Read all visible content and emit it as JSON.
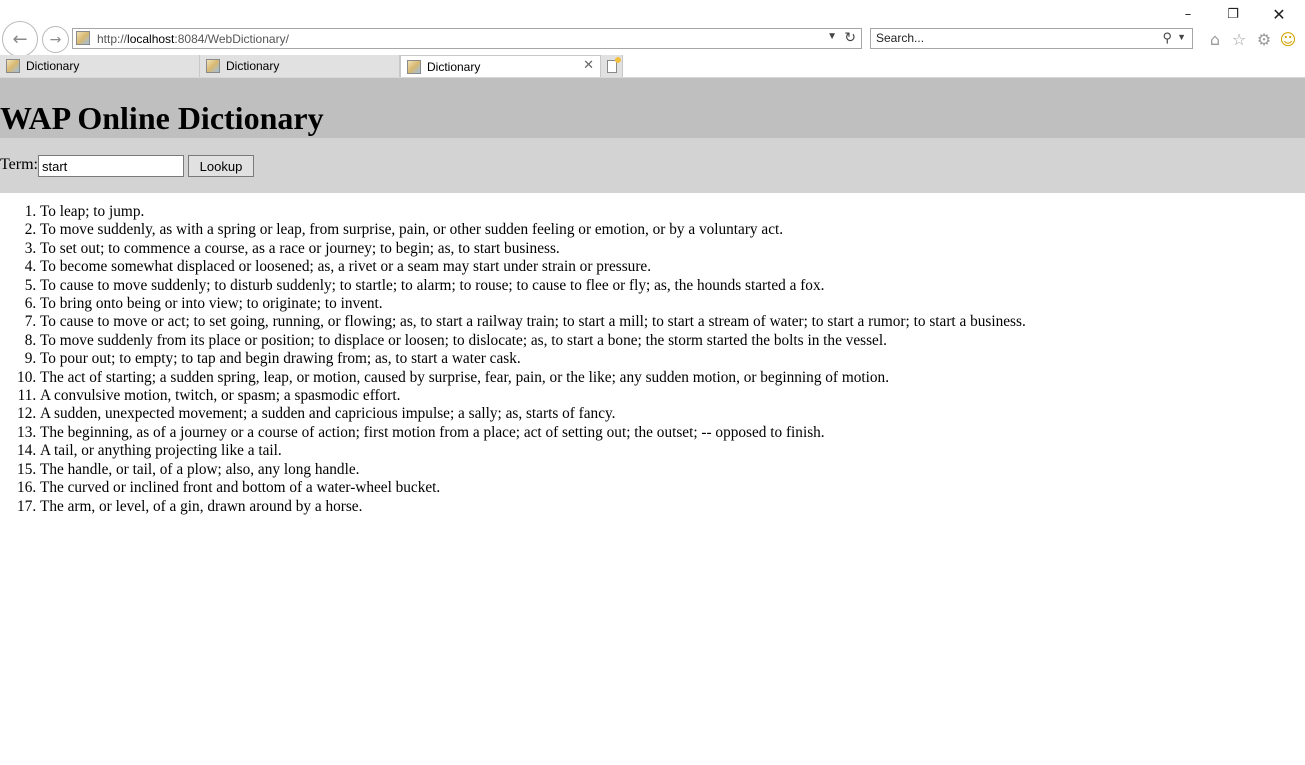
{
  "browser": {
    "address": {
      "url_prefix": "http://",
      "url_host": "localhost",
      "url_rest": ":8084/WebDictionary/"
    },
    "search": {
      "placeholder": "Search..."
    },
    "tabs": [
      {
        "label": "Dictionary",
        "active": false
      },
      {
        "label": "Dictionary",
        "active": false
      },
      {
        "label": "Dictionary",
        "active": true
      }
    ]
  },
  "page": {
    "title": "WAP Online Dictionary",
    "form": {
      "term_label": "Term:",
      "term_value": "start",
      "lookup_label": "Lookup"
    },
    "definitions": [
      "To leap; to jump.",
      "To move suddenly, as with a spring or leap, from surprise, pain, or other sudden feeling or emotion, or by a voluntary act.",
      "To set out; to commence a course, as a race or journey; to begin; as, to start business.",
      "To become somewhat displaced or loosened; as, a rivet or a seam may start under strain or pressure.",
      "To cause to move suddenly; to disturb suddenly; to startle; to alarm; to rouse; to cause to flee or fly; as, the hounds started a fox.",
      "To bring onto being or into view; to originate; to invent.",
      "To cause to move or act; to set going, running, or flowing; as, to start a railway train; to start a mill; to start a stream of water; to start a rumor; to start a business.",
      "To move suddenly from its place or position; to displace or loosen; to dislocate; as, to start a bone; the storm started the bolts in the vessel.",
      "To pour out; to empty; to tap and begin drawing from; as, to start a water cask.",
      "The act of starting; a sudden spring, leap, or motion, caused by surprise, fear, pain, or the like; any sudden motion, or beginning of motion.",
      "A convulsive motion, twitch, or spasm; a spasmodic effort.",
      "A sudden, unexpected movement; a sudden and capricious impulse; a sally; as, starts of fancy.",
      "The beginning, as of a journey or a course of action; first motion from a place; act of setting out; the outset; -- opposed to finish.",
      "A tail, or anything projecting like a tail.",
      "The handle, or tail, of a plow; also, any long handle.",
      "The curved or inclined front and bottom of a water-wheel bucket.",
      "The arm, or level, of a gin, drawn around by a horse."
    ]
  }
}
